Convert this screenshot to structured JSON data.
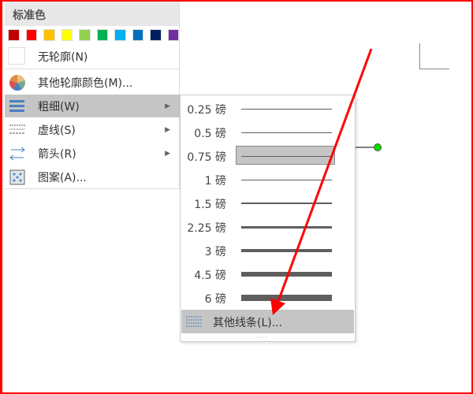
{
  "menu": {
    "header": "标准色",
    "swatches": [
      "#c00000",
      "#ff0000",
      "#ffc000",
      "#ffff00",
      "#92d050",
      "#00b050",
      "#00b0f0",
      "#0070c0",
      "#002060",
      "#7030a0"
    ],
    "items": [
      {
        "label": "无轮廓(N)",
        "icon": "no-outline-icon"
      },
      {
        "label": "其他轮廓颜色(M)...",
        "icon": "color-wheel-icon"
      },
      {
        "label": "粗细(W)",
        "icon": "line-weight-icon",
        "submenu": true,
        "selected": true
      },
      {
        "label": "虚线(S)",
        "icon": "dash-icon",
        "submenu": true
      },
      {
        "label": "箭头(R)",
        "icon": "arrows-icon",
        "submenu": true
      },
      {
        "label": "图案(A)...",
        "icon": "pattern-icon"
      }
    ]
  },
  "weights": {
    "items": [
      {
        "label": "0.25 磅",
        "pt": 0.25
      },
      {
        "label": "0.5 磅",
        "pt": 0.5
      },
      {
        "label": "0.75 磅",
        "pt": 0.75,
        "selected": true
      },
      {
        "label": "1 磅",
        "pt": 1
      },
      {
        "label": "1.5 磅",
        "pt": 1.5
      },
      {
        "label": "2.25 磅",
        "pt": 2.25
      },
      {
        "label": "3 磅",
        "pt": 3
      },
      {
        "label": "4.5 磅",
        "pt": 4.5
      },
      {
        "label": "6 磅",
        "pt": 6
      }
    ],
    "more_label": "其他线条(L)...",
    "grip": "····"
  },
  "colors": {
    "highlight": "#c5c5c5",
    "annotation": "#ff0000",
    "handle": "#00e000"
  }
}
